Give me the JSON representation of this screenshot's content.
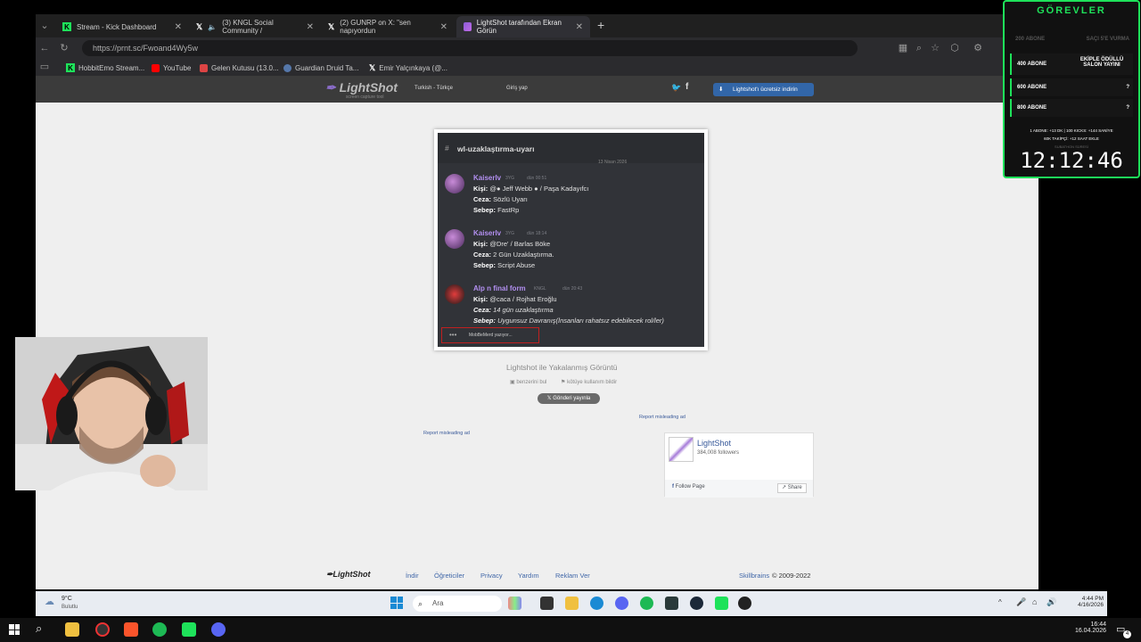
{
  "browser": {
    "tabs": [
      {
        "label": "Stream - Kick Dashboard",
        "favicon": "kick-icon"
      },
      {
        "label": "(3) KNGL Social Community /",
        "favicon": "x-icon"
      },
      {
        "label": "(2) GUNRP on X: \"sen napıyordun",
        "favicon": "x-icon"
      },
      {
        "label": "LightShot tarafından Ekran Görün",
        "favicon": "lightshot-icon"
      }
    ],
    "url": "https://prnt.sc/Fwoand4Wy5w",
    "bookmarks": [
      "HobbitEmo Stream...",
      "YouTube",
      "Gelen Kutusu (13.0...",
      "Guardian Druid Ta...",
      "Emir Yalçınkaya (@..."
    ]
  },
  "lightshot": {
    "logo": "LightShot",
    "tagline": "screen capture tool",
    "lang": "Turkish - Türkçe",
    "login": "Giriş yap",
    "download": "Lightshot'ı ücretsiz indirin",
    "caption": "Lightshot ile Yakalanmış Görüntü",
    "similar": "benzerini bul",
    "report_abuse": "kötüye kullanım bildir",
    "x_post": "Gönderi yayınla",
    "report_ad": "Report misleading ad",
    "fb": {
      "name": "LightShot",
      "followers": "384,008 followers",
      "follow": "Follow Page",
      "share": "Share"
    },
    "footer": {
      "logo": "LightShot",
      "links": [
        "İndir",
        "Öğreticiler",
        "Privacy",
        "Yardım",
        "Reklam Ver"
      ],
      "copyright_brand": "Skillbrains",
      "copyright": "© 2009-2022"
    }
  },
  "screenshot": {
    "channel": "wl-uzaklaştırma-uyarı",
    "date_divider": "13 Nisan 2026",
    "messages": [
      {
        "author": "Kaiserlv",
        "tag": "3YG",
        "time": "dün 00:51",
        "k_label": "Kişi:",
        "kisi": "@● Jeff Webb ●  / Paşa Kadayıfcı",
        "c_label": "Ceza:",
        "ceza": "Sözlü Uyarı",
        "s_label": "Sebep:",
        "sebep": "FastRp"
      },
      {
        "author": "Kaiserlv",
        "tag": "3YG",
        "time": "dün 18:14",
        "k_label": "Kişi:",
        "kisi": "@Dre'  / Barlas Böke",
        "c_label": "Ceza:",
        "ceza": "2 Gün Uzaklaştırma.",
        "s_label": "Sebep:",
        "sebep": "Script Abuse"
      },
      {
        "author": "Alp n final form",
        "tag": "KNGL",
        "time": "dün 20:43",
        "k_label": "Kişi:",
        "kisi": "@caca  / Rojhat Eroğlu",
        "c_label": "Ceza:",
        "ceza": "14 gün uzaklaştırma",
        "s_label": "Sebep:",
        "sebep": "Uygunsuz Davranış(İnsanları rahatsız edebilecek rol/ler)"
      }
    ],
    "typing": "MobBeMerd yazıyor..."
  },
  "overlay": {
    "title": "GÖREVLER",
    "goals": [
      {
        "left": "200 ABONE",
        "right": "SAÇI 5'E VURMA",
        "done": true
      },
      {
        "left": "400 ABONE",
        "right": "EKİPLE ÖDÜLLÜ SALON YAYINI",
        "done": false
      },
      {
        "left": "600 ABONE",
        "right": "?",
        "done": false
      },
      {
        "left": "800 ABONE",
        "right": "?",
        "done": false
      }
    ],
    "rules_line1": "1 ABONE: +13 DK  |  100 KICKS: +144 SANİYE",
    "rules_line2": "60K TAKİPÇİ: +12 SAAT EKLE",
    "timer_label": "SUBATHON SÜRESİ",
    "timer": "12:12:46"
  },
  "vm_taskbar": {
    "weather_temp": "9°C",
    "weather_desc": "Bulutlu",
    "search": "Ara",
    "time": "4:44 PM",
    "date": "4/16/2026"
  },
  "host_taskbar": {
    "time": "16:44",
    "date": "16.04.2026",
    "notif": "4"
  },
  "colors": {
    "accent": "#1ee25a",
    "lightshot_blue": "#3266a8",
    "discord_bg": "#313338"
  }
}
